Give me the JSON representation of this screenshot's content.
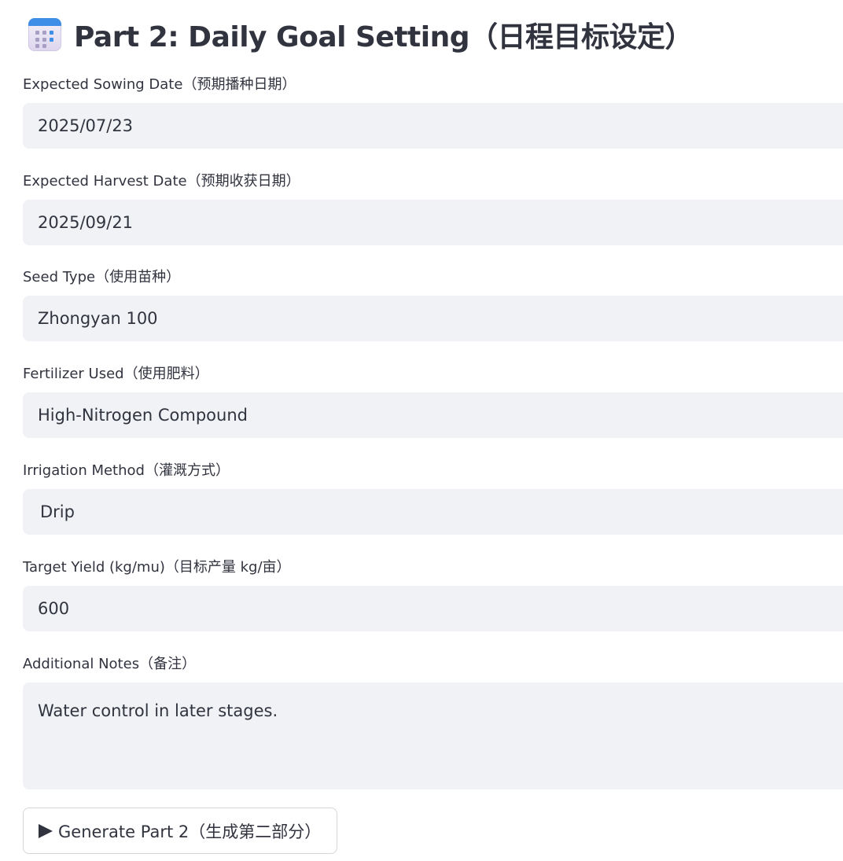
{
  "title": {
    "icon": "calendar-icon",
    "text": "Part 2: Daily Goal Setting（日程目标设定）"
  },
  "fields": [
    {
      "label": "Expected Sowing Date（预期播种日期）",
      "value": "2025/07/23"
    },
    {
      "label": "Expected Harvest Date（预期收获日期）",
      "value": "2025/09/21"
    },
    {
      "label": "Seed Type（使用苗种）",
      "value": "Zhongyan 100"
    },
    {
      "label": "Fertilizer Used（使用肥料）",
      "value": "High-Nitrogen Compound"
    },
    {
      "label": "Irrigation Method（灌溉方式）",
      "value": "Drip"
    },
    {
      "label": "Target Yield (kg/mu)（目标产量 kg/亩）",
      "value": "600"
    }
  ],
  "notes": {
    "label": "Additional Notes（备注）",
    "value": "Water control in later stages."
  },
  "generate_button": {
    "icon": "play-icon",
    "label": "Generate Part 2（生成第二部分）"
  },
  "colors": {
    "input_bg": "#f0f2f6",
    "text": "#31333f",
    "accent_blue": "#3e8ee8"
  }
}
